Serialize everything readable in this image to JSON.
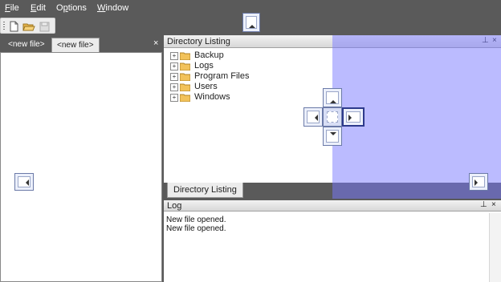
{
  "menu": {
    "items": [
      {
        "label": "File",
        "mnemonic": "F",
        "rest": "ile"
      },
      {
        "label": "Edit",
        "mnemonic": "E",
        "rest": "dit"
      },
      {
        "label": "Options",
        "mnemonic": "p",
        "pre": "O",
        "rest": "tions"
      },
      {
        "label": "Window",
        "mnemonic": "W",
        "rest": "indow"
      }
    ]
  },
  "toolbar": {
    "buttons": [
      "new-document-icon",
      "open-folder-icon",
      "save-disabled-icon"
    ]
  },
  "documents": {
    "tabs": [
      {
        "label": "<new file>",
        "active": false
      },
      {
        "label": "<new file>",
        "active": true
      }
    ],
    "close_glyph": "×"
  },
  "directory_panel": {
    "title": "Directory Listing",
    "pin_glyph": "📌",
    "close_glyph": "×",
    "tree": [
      {
        "label": "Backup",
        "expander": "+"
      },
      {
        "label": "Logs",
        "expander": "+"
      },
      {
        "label": "Program Files",
        "expander": "+"
      },
      {
        "label": "Users",
        "expander": "+"
      },
      {
        "label": "Windows",
        "expander": "+"
      }
    ],
    "tab_label": "Directory Listing"
  },
  "log_panel": {
    "title": "Log",
    "pin_glyph": "📌",
    "close_glyph": "×",
    "lines": [
      "New file opened.",
      "New file opened."
    ]
  },
  "colors": {
    "background": "#5a5a5a",
    "dock_preview": "#7878ff",
    "guide_border": "#6b7aa8"
  }
}
